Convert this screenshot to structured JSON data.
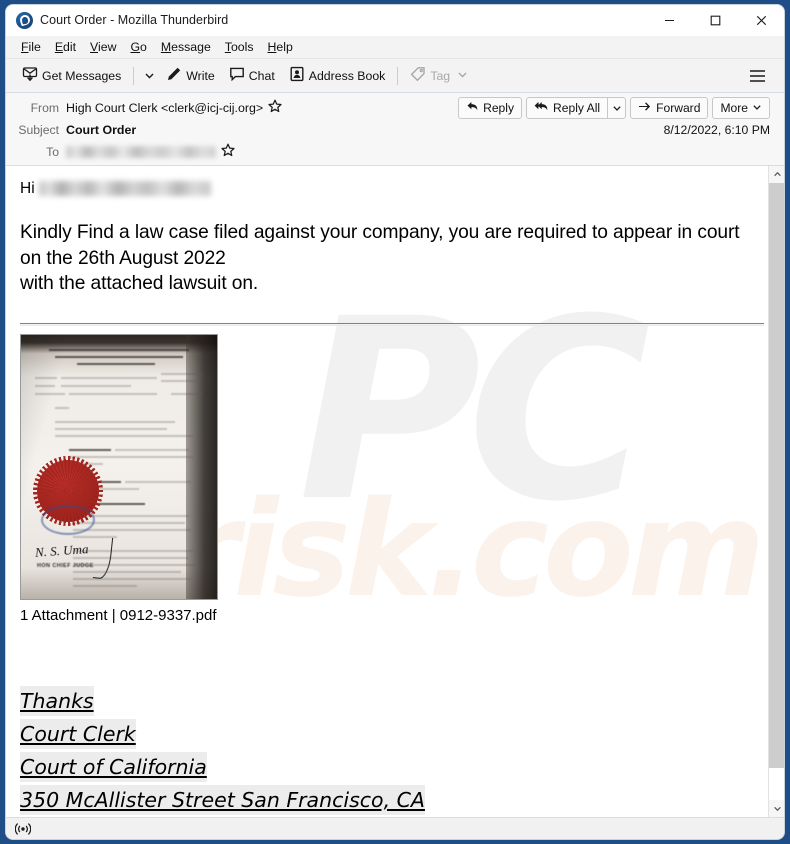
{
  "window": {
    "title": "Court Order - Mozilla Thunderbird",
    "logo_icon": "thunderbird-logo-icon",
    "controls": {
      "minimize": "minimize-icon",
      "maximize": "maximize-icon",
      "close": "close-icon"
    }
  },
  "menu_bar": {
    "items": [
      {
        "label": "File",
        "accesskey": "F"
      },
      {
        "label": "Edit",
        "accesskey": "E"
      },
      {
        "label": "View",
        "accesskey": "V"
      },
      {
        "label": "Go",
        "accesskey": "G"
      },
      {
        "label": "Message",
        "accesskey": "M"
      },
      {
        "label": "Tools",
        "accesskey": "T"
      },
      {
        "label": "Help",
        "accesskey": "H"
      }
    ]
  },
  "toolbar": {
    "get_messages_label": "Get Messages",
    "get_messages_icon": "download-message-icon",
    "get_messages_caret_icon": "chevron-down-icon",
    "write_label": "Write",
    "write_icon": "pencil-icon",
    "chat_label": "Chat",
    "chat_icon": "chat-bubble-icon",
    "address_book_label": "Address Book",
    "address_book_icon": "address-book-icon",
    "tag_label": "Tag",
    "tag_icon": "tag-icon",
    "tag_caret_icon": "chevron-down-icon",
    "tag_disabled": true,
    "app_menu_icon": "hamburger-menu-icon"
  },
  "message_header": {
    "from_label": "From",
    "from_value": "High Court Clerk <clerk@icj-cij.org>",
    "from_star_icon": "star-icon",
    "subject_label": "Subject",
    "subject_value": "Court Order",
    "to_label": "To",
    "to_value_redacted": true,
    "to_star_icon": "star-icon",
    "date": "8/12/2022, 6:10 PM",
    "actions": {
      "reply_label": "Reply",
      "reply_icon": "reply-arrow-icon",
      "reply_all_label": "Reply All",
      "reply_all_icon": "reply-all-arrow-icon",
      "reply_all_caret_icon": "chevron-down-icon",
      "forward_label": "Forward",
      "forward_icon": "forward-arrow-icon",
      "more_label": "More",
      "more_caret_icon": "chevron-down-icon"
    }
  },
  "body": {
    "greeting_prefix": "Hi",
    "greeting_redacted": true,
    "paragraph": "Kindly Find a law case filed against your company, you are required to appear in court on the 26th August 2022\nwith the attached lawsuit on.",
    "attachment": {
      "thumbnail_alt": "court-order-document-photo",
      "label": "1 Attachment | 0912-9337.pdf",
      "count": "1",
      "filename": "0912-9337.pdf",
      "signature_name": "N. S. Uma",
      "signature_title": "HON CHIEF JUDGE"
    },
    "signature_lines": [
      "Thanks",
      "Court Clerk",
      "Court of California",
      "350 McAllister Street San Francisco, CA"
    ]
  },
  "watermark": {
    "line1": "PC",
    "line2": "risk.com"
  },
  "scrollbar": {
    "up_arrow_icon": "chevron-up-icon",
    "down_arrow_icon": "chevron-down-icon"
  },
  "status_bar": {
    "connection_icon": "broadcast-connection-icon"
  },
  "colors": {
    "window_border": "#1f4e87",
    "toolbar_bg": "#f3f3f3",
    "header_bg": "#f7f7f7",
    "seal_red": "#a3251f",
    "stamp_blue": "#2f4b93",
    "signature_highlight": "#ececed"
  }
}
